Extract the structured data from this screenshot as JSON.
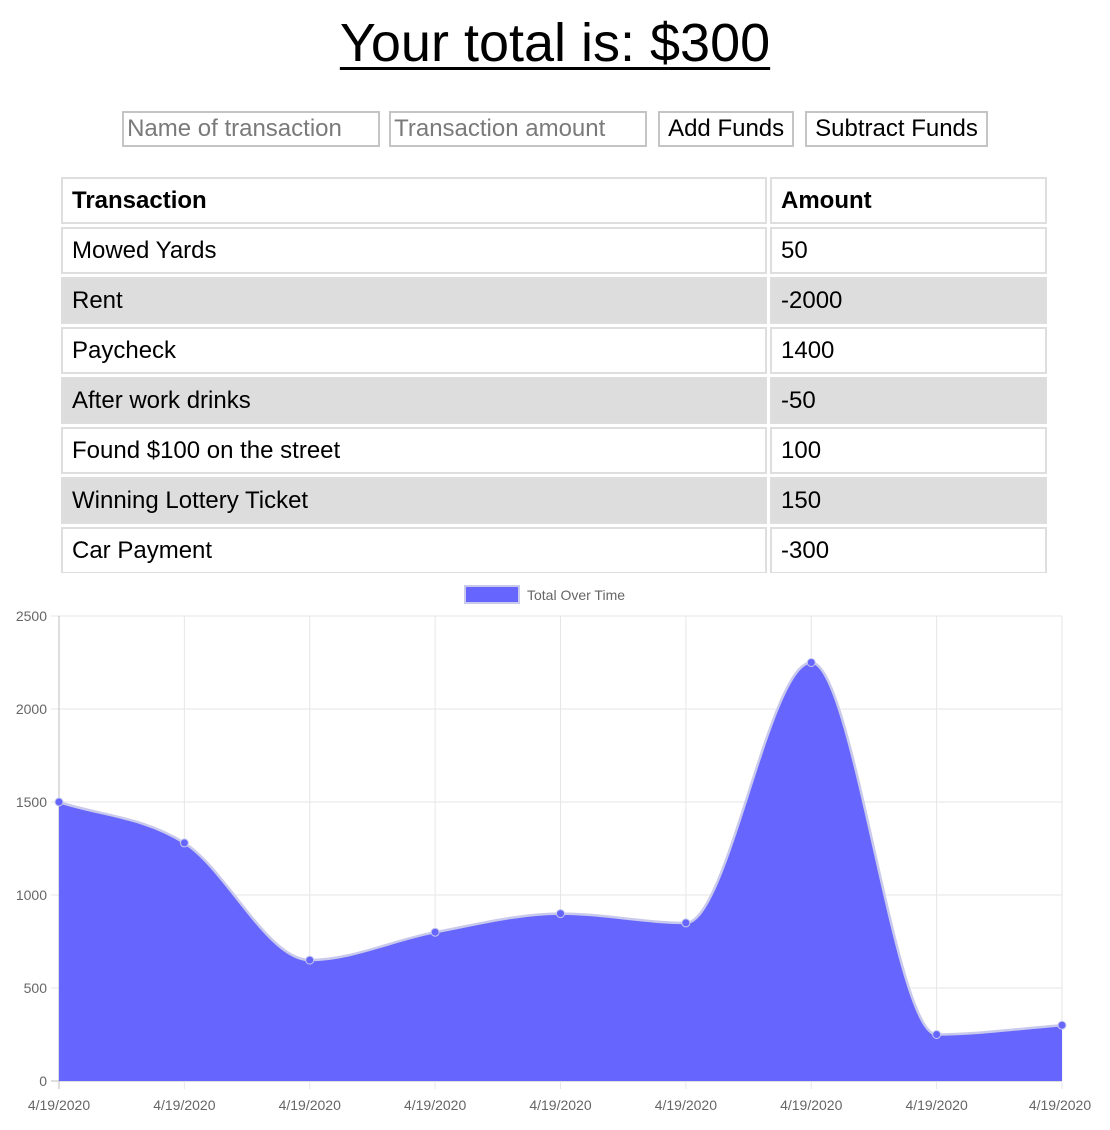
{
  "header": {
    "total_label": "Your total is: $300"
  },
  "form": {
    "name_placeholder": "Name of transaction",
    "amount_placeholder": "Transaction amount",
    "add_label": "Add Funds",
    "subtract_label": "Subtract Funds"
  },
  "table": {
    "headers": [
      "Transaction",
      "Amount"
    ],
    "rows": [
      {
        "name": "Mowed Yards",
        "amount": "50"
      },
      {
        "name": "Rent",
        "amount": "-2000"
      },
      {
        "name": "Paycheck",
        "amount": "1400"
      },
      {
        "name": "After work drinks",
        "amount": "-50"
      },
      {
        "name": "Found $100 on the street",
        "amount": "100"
      },
      {
        "name": "Winning Lottery Ticket",
        "amount": "150"
      },
      {
        "name": "Car Payment",
        "amount": "-300"
      }
    ]
  },
  "colors": {
    "fill": "#6666ff",
    "stroke": "#c9c9ec",
    "row_alt": "#dddddd",
    "border": "#dedede"
  },
  "chart_data": {
    "type": "area",
    "x": [
      "4/19/2020",
      "4/19/2020",
      "4/19/2020",
      "4/19/2020",
      "4/19/2020",
      "4/19/2020",
      "4/19/2020",
      "4/19/2020",
      "4/19/2020"
    ],
    "series": [
      {
        "name": "Total Over Time",
        "values": [
          1500,
          1280,
          650,
          800,
          900,
          850,
          2250,
          250,
          300
        ]
      }
    ],
    "yticks": [
      0,
      500,
      1000,
      1500,
      2000,
      2500
    ],
    "ylim": [
      0,
      2500
    ],
    "grid": true,
    "legend": "top-center"
  }
}
